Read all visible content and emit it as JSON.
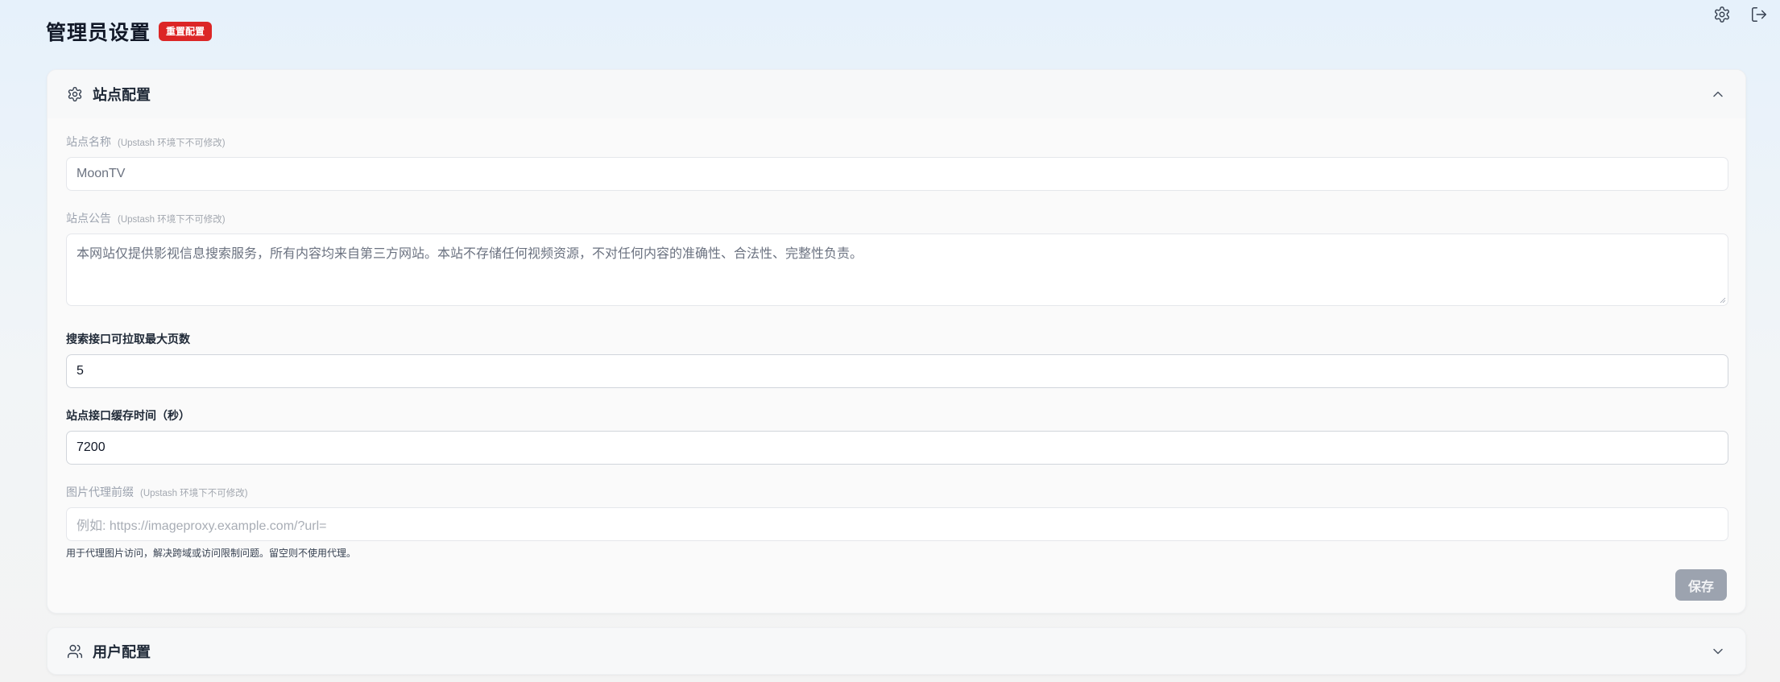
{
  "header": {
    "title": "管理员设置",
    "reset_label": "重置配置",
    "settings_icon": "gear-icon",
    "logout_icon": "logout-icon"
  },
  "site_config": {
    "title": "站点配置",
    "icon": "gear-icon",
    "expanded": true,
    "fields": {
      "site_name": {
        "label": "站点名称",
        "note": "(Upstash 环境下不可修改)",
        "value": "MoonTV"
      },
      "announcement": {
        "label": "站点公告",
        "note": "(Upstash 环境下不可修改)",
        "value": "本网站仅提供影视信息搜索服务，所有内容均来自第三方网站。本站不存储任何视频资源，不对任何内容的准确性、合法性、完整性负责。"
      },
      "max_pages": {
        "label": "搜索接口可拉取最大页数",
        "value": "5"
      },
      "cache_time": {
        "label": "站点接口缓存时间（秒）",
        "value": "7200"
      },
      "image_proxy": {
        "label": "图片代理前缀",
        "note": "(Upstash 环境下不可修改)",
        "placeholder": "例如: https://imageproxy.example.com/?url=",
        "help": "用于代理图片访问，解决跨域或访问限制问题。留空则不使用代理。"
      }
    },
    "save_label": "保存"
  },
  "user_config": {
    "title": "用户配置",
    "icon": "users-icon",
    "expanded": false
  },
  "colors": {
    "reset_button": "#dc2626",
    "save_button_disabled": "#9ca3af"
  }
}
